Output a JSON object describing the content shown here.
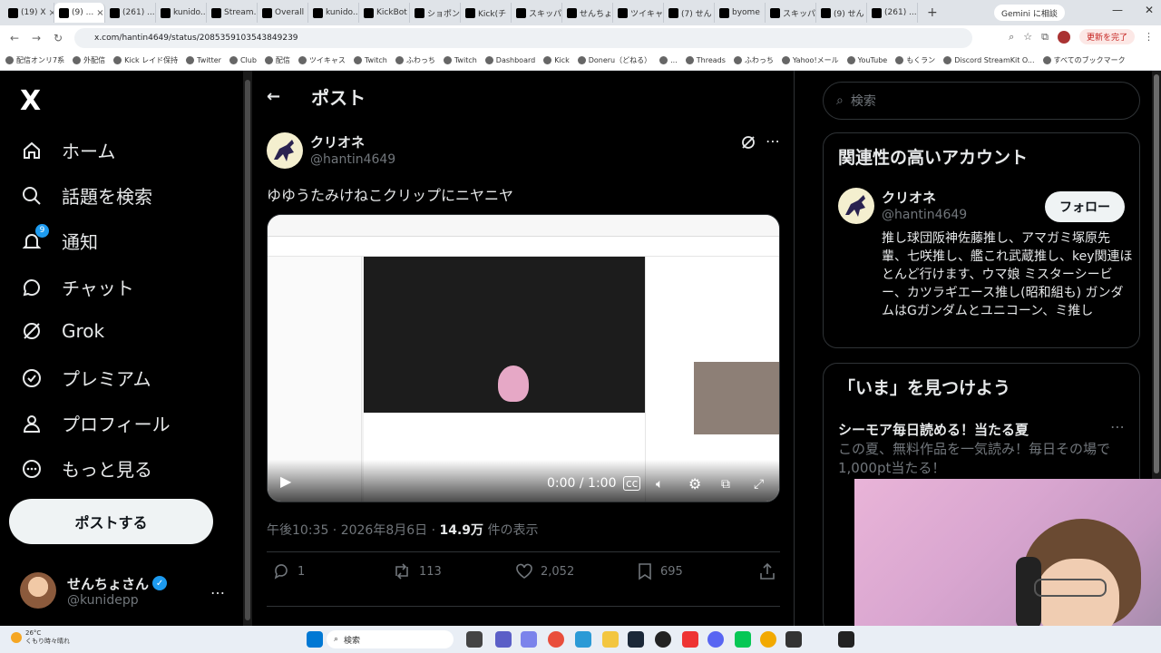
{
  "browser": {
    "tabs": [
      {
        "label": "(19) X"
      },
      {
        "label": "(9) ..."
      },
      {
        "label": "(261) ..."
      },
      {
        "label": "kunido..."
      },
      {
        "label": "Stream..."
      },
      {
        "label": "Overall"
      },
      {
        "label": "kunido..."
      },
      {
        "label": "KickBot"
      },
      {
        "label": "ショポン"
      },
      {
        "label": "Kick(チ"
      },
      {
        "label": "スキッパ"
      },
      {
        "label": "せんちょ"
      },
      {
        "label": "ツイキャ"
      },
      {
        "label": "(7) せん"
      },
      {
        "label": "byome"
      },
      {
        "label": "スキッパ"
      },
      {
        "label": "(9) せん"
      },
      {
        "label": "(261) ..."
      }
    ],
    "new_tab": "+",
    "gemini": "Gemini に相談",
    "url": "x.com/hantin4649/status/2085359103543849239",
    "update_label": "更新を完了",
    "bookmarks": [
      "配信オンリ7系",
      "外配信",
      "Kick レイド保持",
      "Twitter",
      "Club",
      "配信",
      "ツイキャス",
      "Twitch",
      "ふわっち",
      "Twitch",
      "Dashboard",
      "Kick",
      "Doneru（どねる）",
      "...",
      "Threads",
      "ふわっち",
      "Yahoo!メール",
      "YouTube",
      "もくラン",
      "Discord StreamKit O...",
      "すべてのブックマーク"
    ]
  },
  "sidebar": {
    "logo": "X",
    "items": [
      {
        "label": "ホーム",
        "icon": "home-icon"
      },
      {
        "label": "話題を検索",
        "icon": "search-icon"
      },
      {
        "label": "通知",
        "icon": "bell-icon",
        "badge": "9"
      },
      {
        "label": "チャット",
        "icon": "chat-icon"
      },
      {
        "label": "Grok",
        "icon": "grok-icon"
      },
      {
        "label": "プレミアム",
        "icon": "premium-icon"
      },
      {
        "label": "プロフィール",
        "icon": "profile-icon"
      },
      {
        "label": "もっと見る",
        "icon": "more-circle-icon"
      }
    ],
    "post_button": "ポストする",
    "account": {
      "name": "せんちょさん",
      "handle": "@kunidepp",
      "more": "…"
    }
  },
  "main": {
    "header": "ポスト",
    "author": {
      "name": "クリオネ",
      "handle": "@hantin4649"
    },
    "text": "ゆゆうたみけねこクリップにニヤニヤ",
    "video": {
      "time": "0:00 / 1:00"
    },
    "meta": {
      "time": "午後10:35 · 2026年8月6日 · ",
      "views": "14.9万",
      "views_suffix": " 件の表示"
    },
    "actions": {
      "replies": "1",
      "reposts": "113",
      "likes": "2,052",
      "bookmarks": "695"
    }
  },
  "right": {
    "search_placeholder": "検索",
    "related": {
      "title": "関連性の高いアカウント",
      "name": "クリオネ",
      "handle": "@hantin4649",
      "follow": "フォロー",
      "bio": "推し球団阪神佐藤推し、アマガミ塚原先輩、七咲推し、艦これ武蔵推し、key関連ほとんど行けます、ウマ娘 ミスターシービー、カツラギエース推し(昭和組も) ガンダムはGガンダムとユニコーン、ミ推し"
    },
    "trends": {
      "title": "「いま」を見つけよう",
      "item_title": "シーモア毎日読める！当たる夏",
      "item_sub": "この夏、無料作品を一気読み！毎日その場で1,000pt当たる！"
    }
  },
  "taskbar": {
    "weather": "26°C",
    "weather_sub": "くもり時々晴れ",
    "search": "検索"
  },
  "colors": {
    "accent": "#1d9bf0",
    "bg": "#000000",
    "text": "#e7e9ea",
    "muted": "#71767b"
  }
}
